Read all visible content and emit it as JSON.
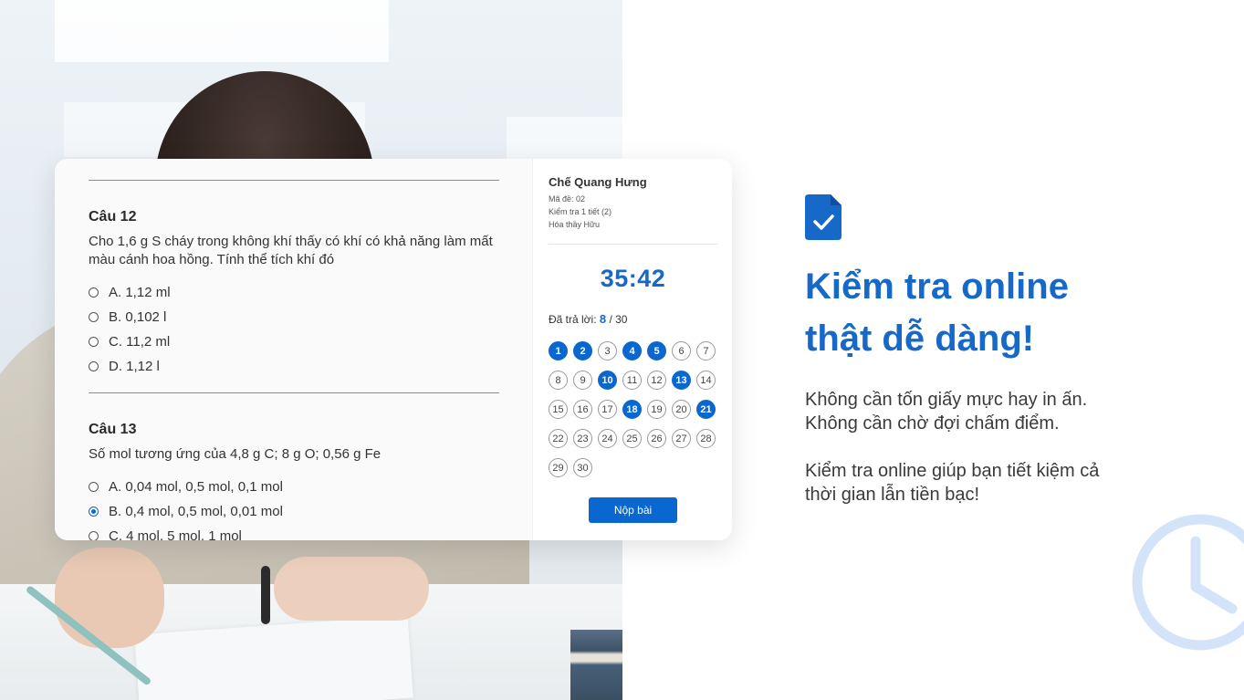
{
  "quiz": {
    "questions": [
      {
        "title": "Câu 12",
        "text": "Cho 1,6 g S cháy trong không khí thấy có khí có khả năng làm mất màu cánh hoa hồng. Tính thể tích khí đó",
        "options": [
          "A. 1,12 ml",
          "B. 0,102 l",
          "C. 11,2 ml",
          "D. 1,12 l"
        ],
        "selected": null
      },
      {
        "title": "Câu 13",
        "text": "Số mol tương ứng của 4,8 g C; 8 g O; 0,56 g Fe",
        "options": [
          "A. 0,04 mol, 0,5 mol, 0,1 mol",
          "B. 0,4 mol, 0,5 mol, 0,01 mol",
          "C. 4 mol, 5 mol, 1 mol"
        ],
        "selected": 1
      }
    ]
  },
  "side": {
    "student_name": "Chế Quang Hưng",
    "exam_code": "Mã đề: 02",
    "exam_name": "Kiểm tra 1 tiết (2)",
    "teacher": "Hóa thầy Hữu",
    "timer": "35:42",
    "answered_label": "Đã trả lời:",
    "answered_count": "8",
    "answered_total": "/ 30",
    "numbers": [
      {
        "n": "1",
        "done": true
      },
      {
        "n": "2",
        "done": true
      },
      {
        "n": "3",
        "done": false
      },
      {
        "n": "4",
        "done": true
      },
      {
        "n": "5",
        "done": true
      },
      {
        "n": "6",
        "done": false
      },
      {
        "n": "7",
        "done": false
      },
      {
        "n": "8",
        "done": false
      },
      {
        "n": "9",
        "done": false
      },
      {
        "n": "10",
        "done": true
      },
      {
        "n": "11",
        "done": false
      },
      {
        "n": "12",
        "done": false
      },
      {
        "n": "13",
        "done": true
      },
      {
        "n": "14",
        "done": false
      },
      {
        "n": "15",
        "done": false
      },
      {
        "n": "16",
        "done": false
      },
      {
        "n": "17",
        "done": false
      },
      {
        "n": "18",
        "done": true
      },
      {
        "n": "19",
        "done": false
      },
      {
        "n": "20",
        "done": false
      },
      {
        "n": "21",
        "done": true
      },
      {
        "n": "22",
        "done": false
      },
      {
        "n": "23",
        "done": false
      },
      {
        "n": "24",
        "done": false
      },
      {
        "n": "25",
        "done": false
      },
      {
        "n": "26",
        "done": false
      },
      {
        "n": "27",
        "done": false
      },
      {
        "n": "28",
        "done": false
      },
      {
        "n": "29",
        "done": false
      },
      {
        "n": "30",
        "done": false
      }
    ],
    "submit_label": "Nộp bài"
  },
  "promo": {
    "icon": "document-check-icon",
    "headline_line1": "Kiểm tra online",
    "headline_line2": "thật dễ dàng!",
    "sub_line1": "Không cần tốn giấy mực hay in ấn.",
    "sub_line2": "Không cần chờ đợi chấm điểm.",
    "sub2_line1": "Kiểm tra online giúp bạn tiết kiệm cả",
    "sub2_line2": "thời gian lẫn tiền bạc!",
    "accent_color": "#1769c9"
  }
}
